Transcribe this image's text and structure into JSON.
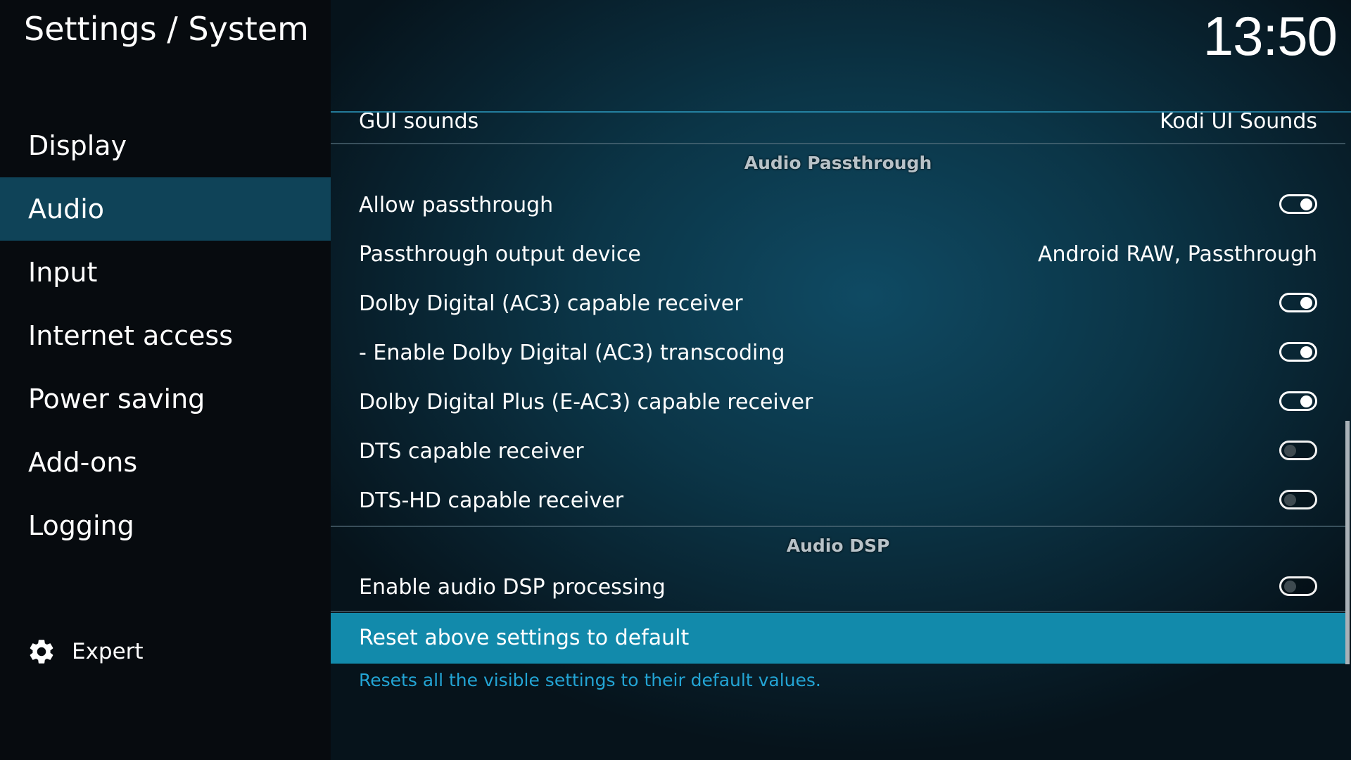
{
  "header": {
    "title": "Settings / System",
    "clock": "13:50"
  },
  "sidebar": {
    "items": [
      {
        "label": "Display",
        "active": false
      },
      {
        "label": "Audio",
        "active": true
      },
      {
        "label": "Input",
        "active": false
      },
      {
        "label": "Internet access",
        "active": false
      },
      {
        "label": "Power saving",
        "active": false
      },
      {
        "label": "Add-ons",
        "active": false
      },
      {
        "label": "Logging",
        "active": false
      }
    ],
    "level": {
      "icon": "gear-icon",
      "label": "Expert"
    }
  },
  "settings": {
    "gui_sounds": {
      "label": "GUI sounds",
      "value": "Kodi UI Sounds"
    },
    "section_passthrough": "Audio Passthrough",
    "allow_passthrough": {
      "label": "Allow passthrough",
      "enabled": true
    },
    "passthrough_device": {
      "label": "Passthrough output device",
      "value": "Android RAW, Passthrough"
    },
    "ac3_receiver": {
      "label": "Dolby Digital (AC3) capable receiver",
      "enabled": true
    },
    "ac3_transcoding": {
      "label": "- Enable Dolby Digital (AC3) transcoding",
      "enabled": true
    },
    "eac3_receiver": {
      "label": "Dolby Digital Plus (E-AC3) capable receiver",
      "enabled": true
    },
    "dts_receiver": {
      "label": "DTS capable receiver",
      "enabled": false
    },
    "dtshd_receiver": {
      "label": "DTS-HD capable receiver",
      "enabled": false
    },
    "section_dsp": "Audio DSP",
    "dsp_processing": {
      "label": "Enable audio DSP processing",
      "enabled": false
    },
    "reset": {
      "label": "Reset above settings to default"
    }
  },
  "description": "Resets all the visible settings to their default values.",
  "colors": {
    "accent": "#128aab",
    "sidebar_active": "#0f4358",
    "description_text": "#23a4d4"
  }
}
